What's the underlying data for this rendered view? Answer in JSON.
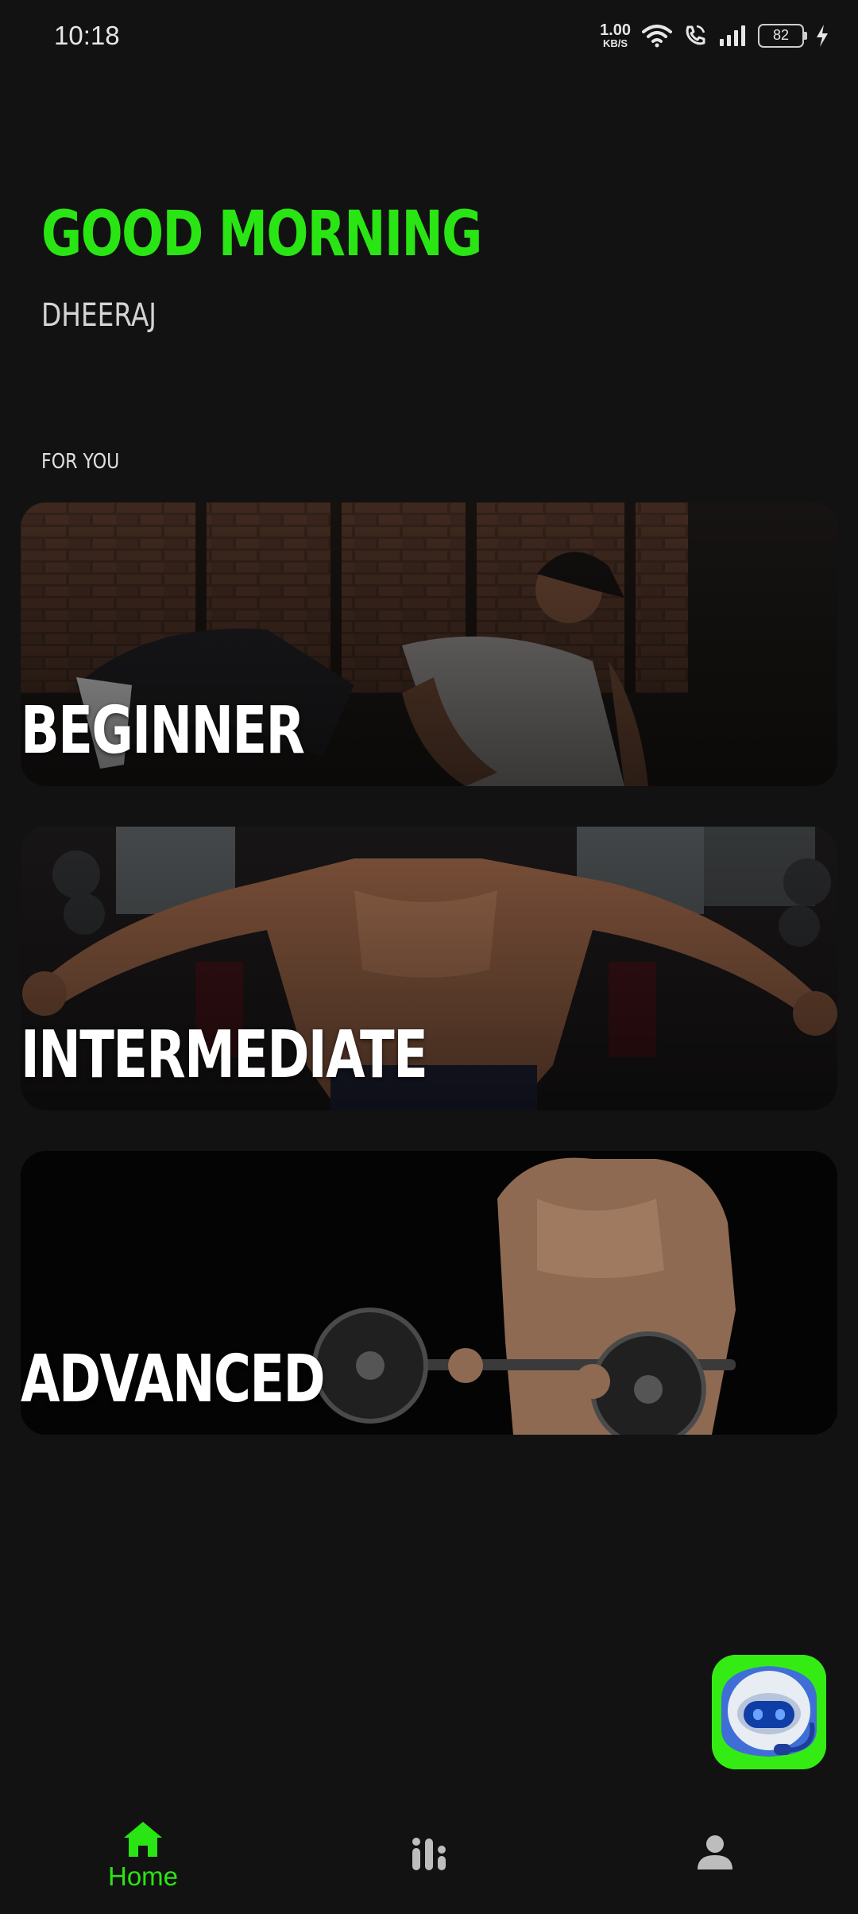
{
  "status_bar": {
    "time": "10:18",
    "net_speed_value": "1.00",
    "net_speed_unit": "KB/S",
    "battery": "82",
    "icons": [
      "wifi-icon",
      "wifi-call-icon",
      "signal-icon",
      "battery-icon",
      "charging-icon"
    ]
  },
  "header": {
    "greeting": "GOOD MORNING",
    "username": "DHEERAJ"
  },
  "section": {
    "label": "FOR YOU"
  },
  "cards": [
    {
      "title": "BEGINNER"
    },
    {
      "title": "INTERMEDIATE"
    },
    {
      "title": "ADVANCED"
    }
  ],
  "fab": {
    "icon": "chatbot-robot-icon"
  },
  "bottom_nav": {
    "items": [
      {
        "label": "Home",
        "icon": "home-icon",
        "active": true
      },
      {
        "label": "",
        "icon": "stats-icon",
        "active": false
      },
      {
        "label": "",
        "icon": "profile-icon",
        "active": false
      }
    ]
  },
  "colors": {
    "accent": "#2ae514",
    "background": "#121212",
    "inactive_icon": "#bdbdbd"
  }
}
